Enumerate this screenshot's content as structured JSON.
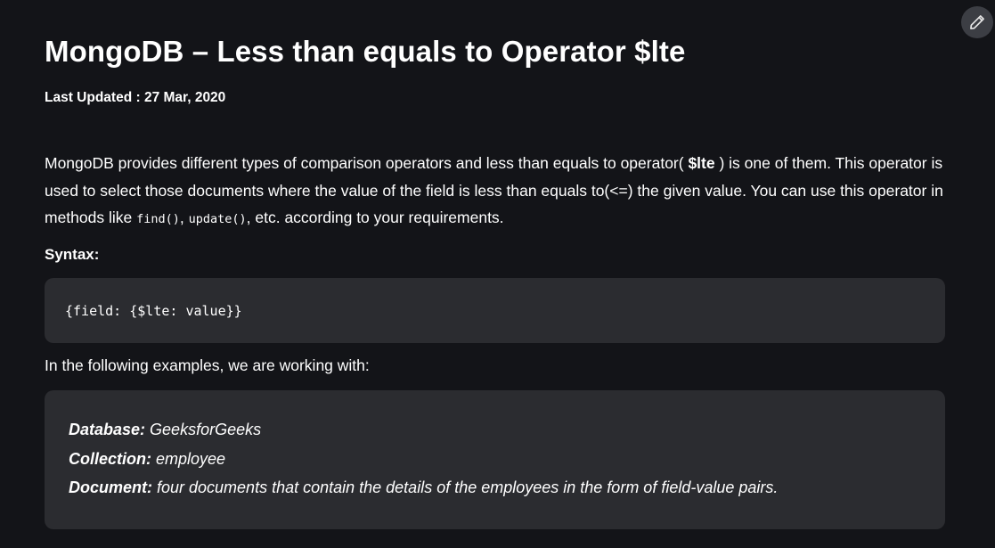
{
  "article": {
    "title": "MongoDB – Less than equals to Operator $lte",
    "last_updated": "Last Updated : 27 Mar, 2020",
    "intro": {
      "part1": "MongoDB provides different types of comparison operators and less than equals to operator( ",
      "operator": "$lte",
      "part2": " ) is one of them. This operator is used to select those documents where the value of the field is less than equals to(<=) the given value. You can use this operator in methods like ",
      "method1": "find()",
      "sep": ", ",
      "method2": "update()",
      "part3": ", etc. according to your requirements."
    },
    "syntax_label": "Syntax:",
    "syntax_code": "{field: {$lte: value}}",
    "working_with": "In the following examples, we are working with:",
    "info": {
      "database_label": "Database:",
      "database_value": " GeeksforGeeks",
      "collection_label": "Collection:",
      "collection_value": " employee",
      "document_label": "Document:",
      "document_value": " four documents that contain the details of the employees in the form of field-value pairs."
    }
  },
  "icons": {
    "edit": "pencil-icon"
  }
}
